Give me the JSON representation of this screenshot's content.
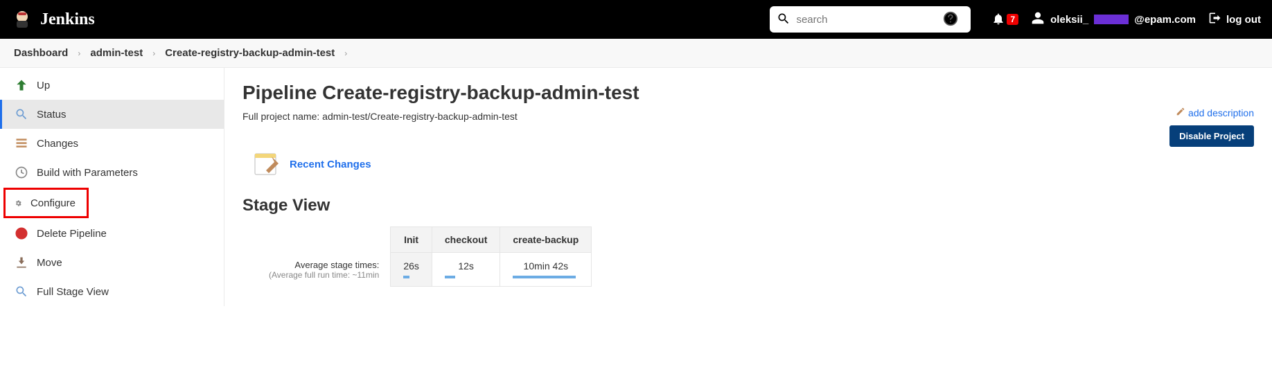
{
  "header": {
    "brand": "Jenkins",
    "search_placeholder": "search",
    "notif_count": "7",
    "username": "oleksii_",
    "user_suffix": "@epam.com",
    "logout": "log out"
  },
  "breadcrumbs": [
    "Dashboard",
    "admin-test",
    "Create-registry-backup-admin-test"
  ],
  "sidebar": {
    "up": "Up",
    "status": "Status",
    "changes": "Changes",
    "build_params": "Build with Parameters",
    "configure": "Configure",
    "delete": "Delete Pipeline",
    "move": "Move",
    "full_stage": "Full Stage View"
  },
  "main": {
    "title": "Pipeline Create-registry-backup-admin-test",
    "subtitle": "Full project name: admin-test/Create-registry-backup-admin-test",
    "add_description": "add description",
    "disable_project": "Disable Project",
    "recent_changes": "Recent Changes",
    "stage_view_title": "Stage View",
    "stage": {
      "cols": [
        "Init",
        "checkout",
        "create-backup"
      ],
      "avg_label": "Average stage times:",
      "avg_sub": "(Average full run time: ~11min",
      "avg_values": [
        "26s",
        "12s",
        "10min 42s"
      ]
    }
  }
}
